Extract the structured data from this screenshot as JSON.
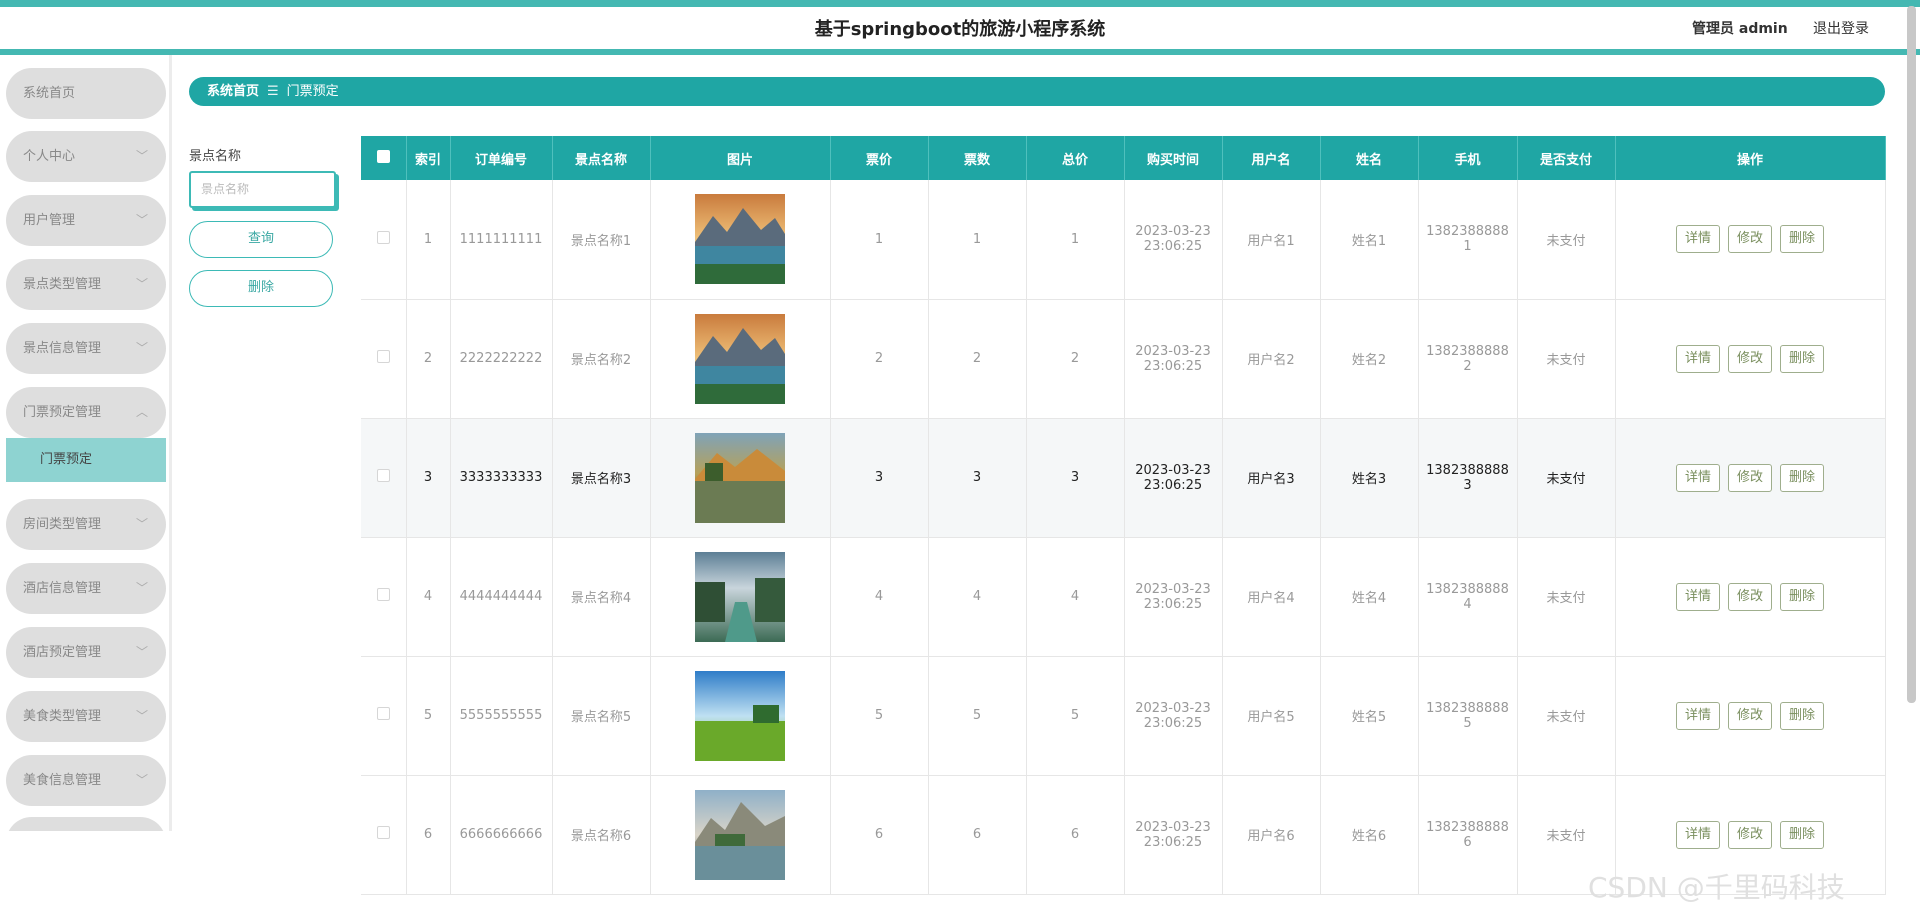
{
  "header": {
    "title": "基于springboot的旅游小程序系统",
    "user": "管理员 admin",
    "logout": "退出登录"
  },
  "sidebar": {
    "items": [
      {
        "label": "系统首页",
        "chevron": ""
      },
      {
        "label": "个人中心",
        "chevron": "﹀"
      },
      {
        "label": "用户管理",
        "chevron": "﹀"
      },
      {
        "label": "景点类型管理",
        "chevron": "﹀"
      },
      {
        "label": "景点信息管理",
        "chevron": "﹀"
      },
      {
        "label": "门票预定管理",
        "chevron": "︿"
      },
      {
        "label": "房间类型管理",
        "chevron": "﹀"
      },
      {
        "label": "酒店信息管理",
        "chevron": "﹀"
      },
      {
        "label": "酒店预定管理",
        "chevron": "﹀"
      },
      {
        "label": "美食类型管理",
        "chevron": "﹀"
      },
      {
        "label": "美食信息管理",
        "chevron": "﹀"
      }
    ],
    "active_sub": "门票预定"
  },
  "breadcrumb": {
    "home": "系统首页",
    "sep": "☰",
    "current": "门票预定"
  },
  "search": {
    "label": "景点名称",
    "placeholder": "景点名称",
    "query_btn": "查询",
    "delete_btn": "删除"
  },
  "table": {
    "headers": [
      "索引",
      "订单编号",
      "景点名称",
      "图片",
      "票价",
      "票数",
      "总价",
      "购买时间",
      "用户名",
      "姓名",
      "手机",
      "是否支付",
      "操作"
    ],
    "actions": {
      "detail": "详情",
      "edit": "修改",
      "delete": "删除"
    },
    "rows": [
      {
        "idx": "1",
        "order": "1111111111",
        "spot": "景点名称1",
        "image": "mountain-lake-sunset",
        "price": "1",
        "qty": "1",
        "total": "1",
        "time1": "2023-03-23",
        "time2": "23:06:25",
        "user": "用户名1",
        "name": "姓名1",
        "phone1": "1382388888",
        "phone2": "1",
        "paid": "未支付"
      },
      {
        "idx": "2",
        "order": "2222222222",
        "spot": "景点名称2",
        "image": "mountain-lake-sunset",
        "price": "2",
        "qty": "2",
        "total": "2",
        "time1": "2023-03-23",
        "time2": "23:06:25",
        "user": "用户名2",
        "name": "姓名2",
        "phone1": "1382388888",
        "phone2": "2",
        "paid": "未支付"
      },
      {
        "idx": "3",
        "order": "3333333333",
        "spot": "景点名称3",
        "image": "autumn-lake",
        "price": "3",
        "qty": "3",
        "total": "3",
        "time1": "2023-03-23",
        "time2": "23:06:25",
        "user": "用户名3",
        "name": "姓名3",
        "phone1": "1382388888",
        "phone2": "3",
        "paid": "未支付"
      },
      {
        "idx": "4",
        "order": "4444444444",
        "spot": "景点名称4",
        "image": "river-forest",
        "price": "4",
        "qty": "4",
        "total": "4",
        "time1": "2023-03-23",
        "time2": "23:06:25",
        "user": "用户名4",
        "name": "姓名4",
        "phone1": "1382388888",
        "phone2": "4",
        "paid": "未支付"
      },
      {
        "idx": "5",
        "order": "5555555555",
        "spot": "景点名称5",
        "image": "green-field-sky",
        "price": "5",
        "qty": "5",
        "total": "5",
        "time1": "2023-03-23",
        "time2": "23:06:25",
        "user": "用户名5",
        "name": "姓名5",
        "phone1": "1382388888",
        "phone2": "5",
        "paid": "未支付"
      },
      {
        "idx": "6",
        "order": "6666666666",
        "spot": "景点名称6",
        "image": "alpine-lake",
        "price": "6",
        "qty": "6",
        "total": "6",
        "time1": "2023-03-23",
        "time2": "23:06:25",
        "user": "用户名6",
        "name": "姓名6",
        "phone1": "1382388888",
        "phone2": "6",
        "paid": "未支付"
      }
    ]
  },
  "watermark": "CSDN @千里码科技",
  "colors": {
    "accent": "#1fa6a4",
    "topbar_border": "#44b8b2",
    "active_sub": "#8ed3d1"
  }
}
